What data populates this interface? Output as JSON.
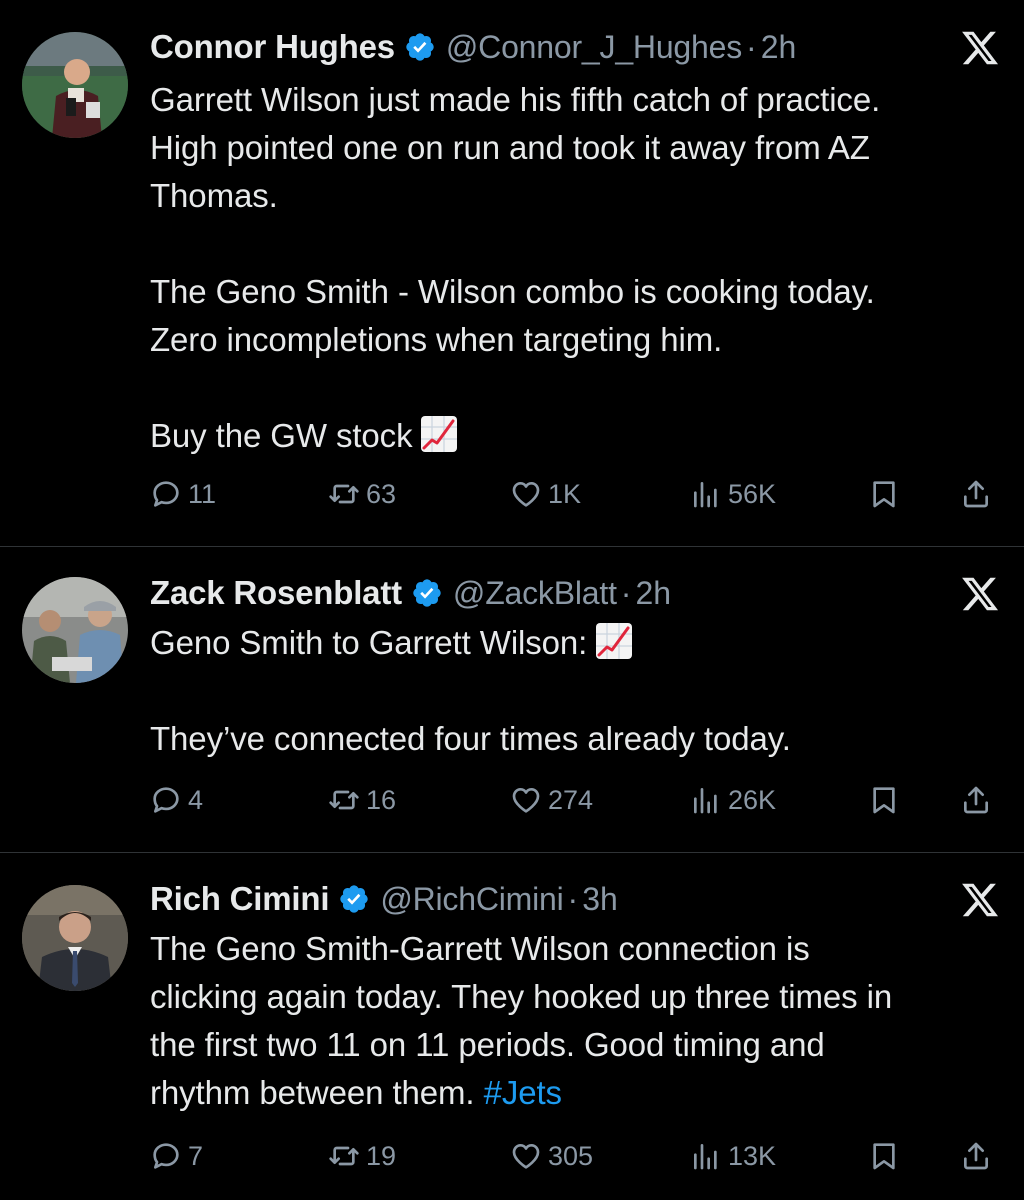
{
  "tweets": [
    {
      "name": "Connor Hughes",
      "handle": "@Connor_J_Hughes",
      "separator": "·",
      "time": "2h",
      "lines": [
        "Garrett Wilson just made his fifth catch of practice.",
        "High pointed one on run and took it away from AZ",
        "Thomas.",
        "",
        "The Geno Smith - Wilson combo is cooking today.",
        "Zero incompletions when targeting him.",
        "",
        "Buy the GW stock"
      ],
      "emoji": "chart-increasing-emoji",
      "stats": {
        "replies": "11",
        "retweets": "63",
        "likes": "1K",
        "views": "56K"
      }
    },
    {
      "name": "Zack Rosenblatt",
      "handle": "@ZackBlatt",
      "separator": "·",
      "time": "2h",
      "lines": [
        "Geno Smith to Garrett Wilson:",
        "",
        "They’ve connected four times already today."
      ],
      "emoji": "chart-increasing-emoji",
      "stats": {
        "replies": "4",
        "retweets": "16",
        "likes": "274",
        "views": "26K"
      }
    },
    {
      "name": "Rich Cimini",
      "handle": "@RichCimini",
      "separator": "·",
      "time": "3h",
      "lines": [
        "The Geno Smith-Garrett Wilson connection is",
        "clicking again today. They hooked up three times in",
        "the first two 11 on 11 periods. Good timing and",
        "rhythm between them."
      ],
      "hashtag": "#Jets",
      "stats": {
        "replies": "7",
        "retweets": "19",
        "likes": "305",
        "views": "13K"
      }
    }
  ],
  "icons": {
    "verified": "verified-badge-icon",
    "platform": "x-logo-icon",
    "reply": "reply-icon",
    "retweet": "retweet-icon",
    "like": "heart-icon",
    "views": "views-icon",
    "bookmark": "bookmark-icon",
    "share": "share-icon"
  },
  "colors": {
    "background": "#000000",
    "text": "#e7e9ea",
    "secondary": "#8b98a5",
    "verified": "#1d9bf0",
    "hashtag": "#1d9bf0",
    "divider": "#2f3336"
  }
}
